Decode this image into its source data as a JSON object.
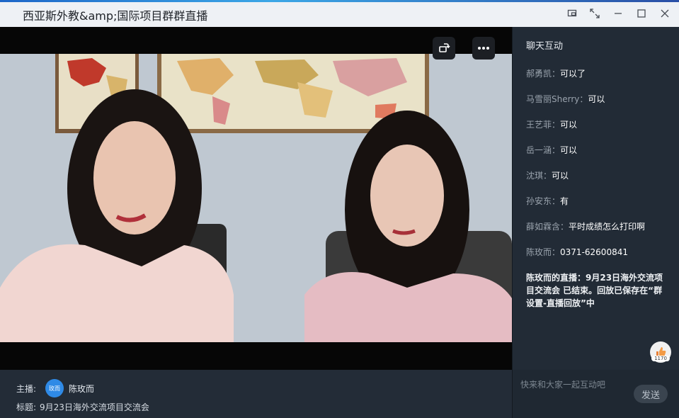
{
  "window": {
    "title": "西亚斯外教&amp;国际项目群群直播",
    "controls": [
      "pin-icon",
      "fullscreen-icon",
      "minimize-icon",
      "maximize-icon",
      "close-icon"
    ]
  },
  "video": {
    "rotate_icon": "rotate-screen-icon",
    "more_icon": "more-icon"
  },
  "info": {
    "host_label": "主播:",
    "host_avatar_text": "玫而",
    "host_name": "陈玫而",
    "title_label": "标题:",
    "title_value": "9月23日海外交流项目交流会"
  },
  "chat": {
    "header": "聊天互动",
    "messages": [
      {
        "who": "郝勇凯",
        "text": "可以了"
      },
      {
        "who": "马雪丽Sherry",
        "text": "可以"
      },
      {
        "who": "王艺菲",
        "text": "可以"
      },
      {
        "who": "岳一涵",
        "text": "可以"
      },
      {
        "who": "沈琪",
        "text": "可以"
      },
      {
        "who": "孙安东",
        "text": "有"
      },
      {
        "who": "薛如霖含",
        "text": "平时成绩怎么打印啊"
      },
      {
        "who": "陈玫而",
        "text": "0371-62600841"
      }
    ],
    "system_message": "陈玫而的直播：9月23日海外交流项目交流会 已结束。回放已保存在“群设置-直播回放”中",
    "like_count": "1170",
    "input_placeholder": "快来和大家一起互动吧",
    "send_label": "发送"
  },
  "colors": {
    "accent": "#2f8ae6",
    "chat_bg": "#222b36",
    "title_bar": "#eef1f5"
  }
}
